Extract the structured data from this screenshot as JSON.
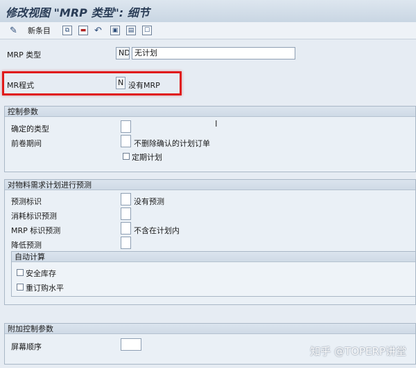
{
  "window": {
    "title": "修改视图 \"MRP 类型\": 细节"
  },
  "toolbar": {
    "new_entries_label": "新条目"
  },
  "header": {
    "mrp_type": {
      "label": "MRP 类型",
      "code": "ND",
      "description": "无计划"
    },
    "mrp_procedure": {
      "label": "MR程式",
      "code": "N",
      "description": "没有MRP"
    }
  },
  "control": {
    "title": "控制参数",
    "firm_type_label": "确定的类型",
    "roll_forward_label": "前卷期间",
    "roll_forward_desc": "不删除确认的计划订单",
    "periodic_planning_label": "定期计划"
  },
  "forecast": {
    "title": "对物料需求计划进行预测",
    "forecast_ind_label": "预测标识",
    "forecast_ind_desc": "没有预测",
    "consumption_label": "消耗标识预测",
    "mrp_ind_label": "MRP 标识预测",
    "mrp_ind_desc": "不含在计划内",
    "reduce_label": "降低预测",
    "auto_calc": {
      "title": "自动计算",
      "safety_stock_label": "安全库存",
      "reorder_level_label": "重订购水平"
    }
  },
  "additional": {
    "title": "附加控制参数",
    "screen_sequence_label": "屏幕顺序"
  },
  "watermark": "知乎 @TOPERP讲堂"
}
